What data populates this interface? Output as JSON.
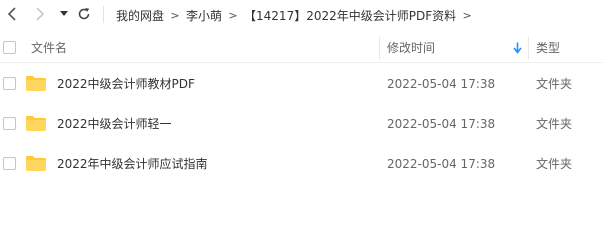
{
  "toolbar": {
    "back_icon": "chevron-left-icon",
    "forward_icon": "chevron-right-icon",
    "history_icon": "caret-down-icon",
    "refresh_icon": "refresh-icon"
  },
  "breadcrumb": {
    "items": [
      "我的网盘",
      "李小萌",
      "【14217】2022年中级会计师PDF资料"
    ],
    "separator": ">"
  },
  "header": {
    "name": "文件名",
    "modified": "修改时间",
    "type": "类型",
    "sort_icon": "arrow-down-icon"
  },
  "rows": [
    {
      "name": "2022中级会计师教材PDF",
      "modified": "2022-05-04 17:38",
      "type": "文件夹",
      "icon": "folder-icon"
    },
    {
      "name": "2022中级会计师轻一",
      "modified": "2022-05-04 17:38",
      "type": "文件夹",
      "icon": "folder-icon"
    },
    {
      "name": "2022年中级会计师应试指南",
      "modified": "2022-05-04 17:38",
      "type": "文件夹",
      "icon": "folder-icon"
    }
  ],
  "colors": {
    "folder": "#FFC93A",
    "sort_arrow": "#1E90FF",
    "text": "#333333",
    "muted": "#666666"
  }
}
